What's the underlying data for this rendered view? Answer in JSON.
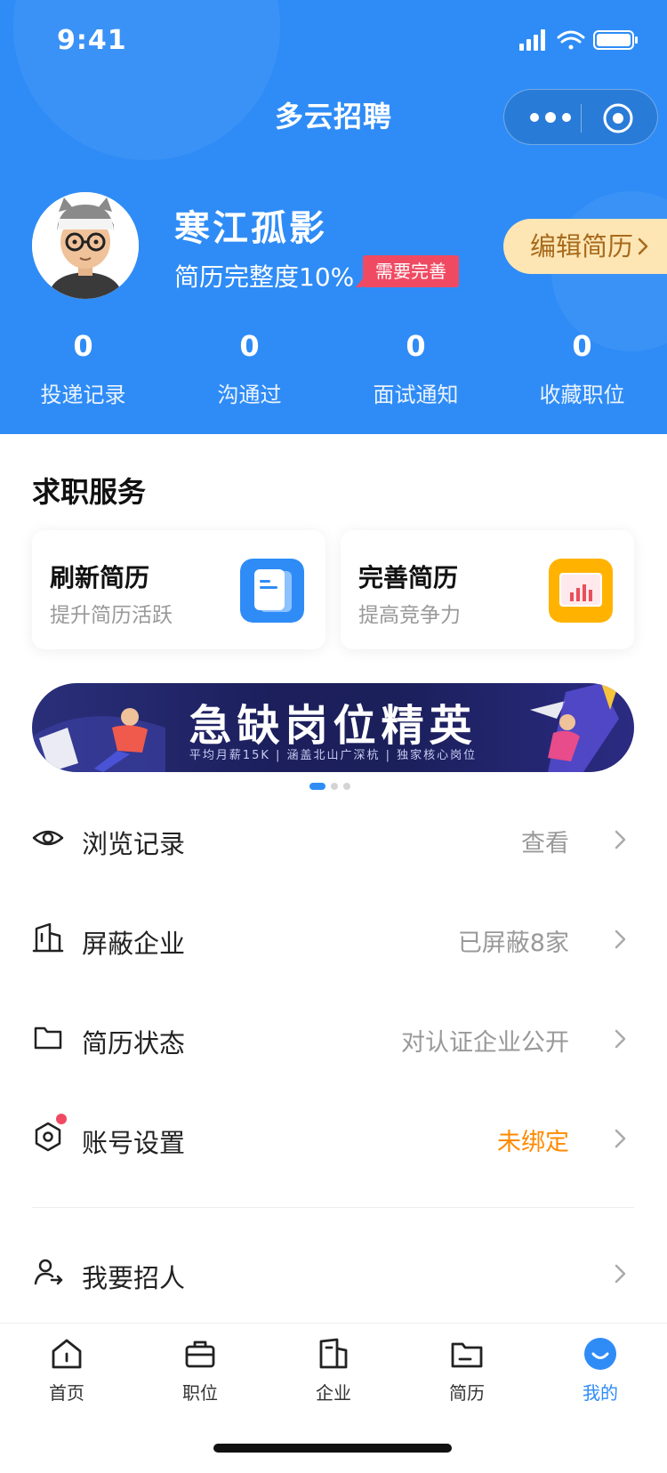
{
  "status_bar": {
    "time": "9:41"
  },
  "app": {
    "title": "多云招聘"
  },
  "profile": {
    "name": "寒江孤影",
    "completeness": "简历完整度10%",
    "badge": "需要完善",
    "edit_button": "编辑简历"
  },
  "stats": [
    {
      "count": "0",
      "label": "投递记录"
    },
    {
      "count": "0",
      "label": "沟通过"
    },
    {
      "count": "0",
      "label": "面试通知"
    },
    {
      "count": "0",
      "label": "收藏职位"
    }
  ],
  "services": {
    "title": "求职服务",
    "cards": [
      {
        "title": "刷新简历",
        "subtitle": "提升简历活跃",
        "icon": "resume-doc-icon",
        "color": "#2f8cf6"
      },
      {
        "title": "完善简历",
        "subtitle": "提高竞争力",
        "icon": "chart-board-icon",
        "color": "#ffb300"
      }
    ]
  },
  "banner": {
    "title": "急缺岗位精英",
    "subtitle": "平均月薪15K | 涵盖北山广深杭 | 独家核心岗位",
    "active_index": 0,
    "count": 3
  },
  "menu": [
    {
      "icon": "eye-icon",
      "label": "浏览记录",
      "value": "查看",
      "value_color": "#999999"
    },
    {
      "icon": "building-icon",
      "label": "屏蔽企业",
      "value": "已屏蔽8家",
      "value_color": "#999999"
    },
    {
      "icon": "folder-icon",
      "label": "简历状态",
      "value": "对认证企业公开",
      "value_color": "#999999"
    },
    {
      "icon": "settings-icon",
      "label": "账号设置",
      "value": "未绑定",
      "value_color": "#ff8a00"
    }
  ],
  "recruit": {
    "icon": "recruiter-icon",
    "label": "我要招人"
  },
  "tabbar": {
    "active": "我的",
    "items": [
      {
        "label": "首页",
        "icon": "home-icon"
      },
      {
        "label": "职位",
        "icon": "briefcase-icon"
      },
      {
        "label": "企业",
        "icon": "company-icon"
      },
      {
        "label": "简历",
        "icon": "resume-folder-icon"
      },
      {
        "label": "我的",
        "icon": "profile-smile-icon"
      }
    ]
  },
  "colors": {
    "primary": "#2f8cf6",
    "accent_orange": "#ff8a00",
    "badge_red": "#f04a63",
    "edit_bg": "#fde6b4"
  }
}
